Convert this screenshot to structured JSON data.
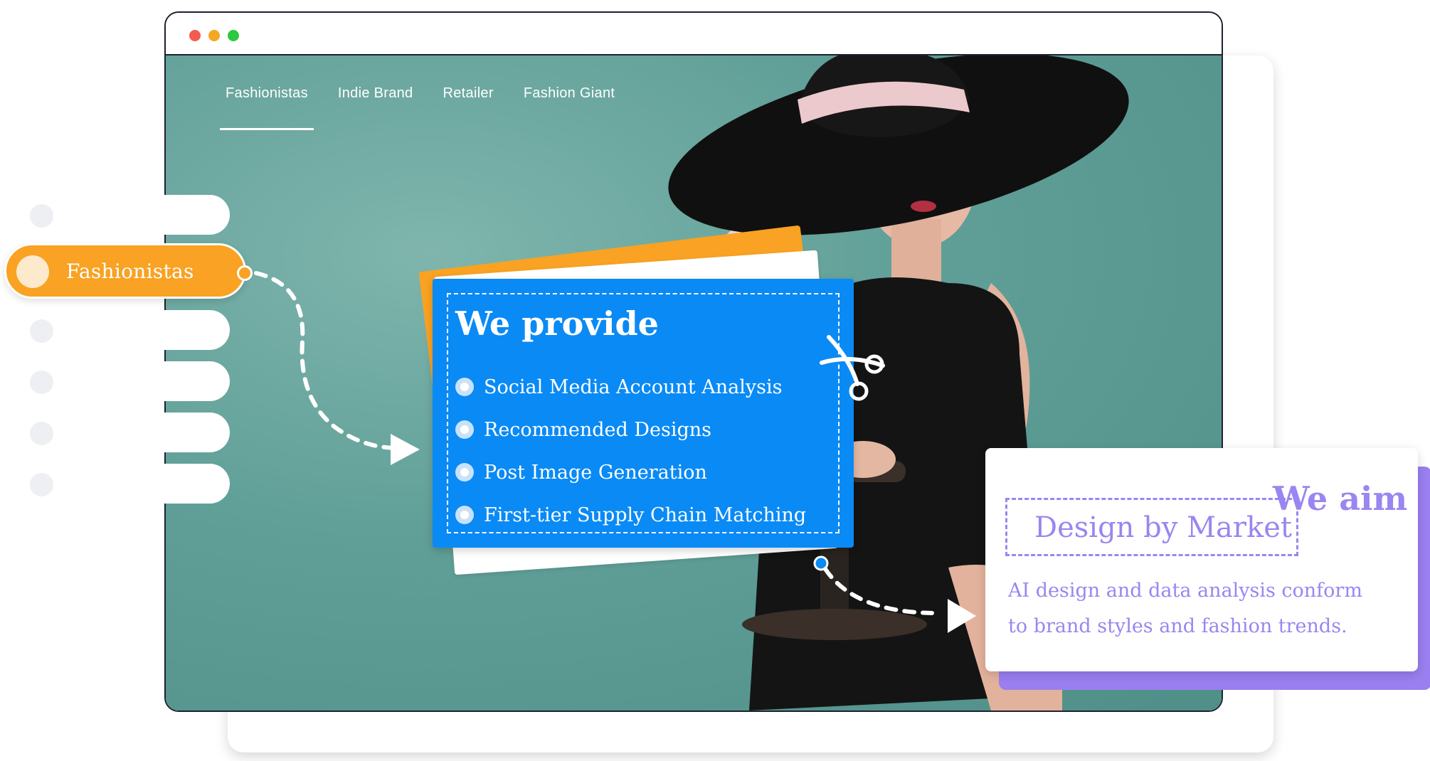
{
  "window": {
    "controls": [
      "close",
      "minimize",
      "maximize"
    ]
  },
  "nav": {
    "items": [
      "Fashionistas",
      "Indie Brand",
      "Retailer",
      "Fashion Giant"
    ],
    "active": "Fashionistas"
  },
  "sidebar": {
    "active_label": "Fashionistas"
  },
  "provide": {
    "title": "We provide",
    "items": [
      "Social Media Account Analysis",
      "Recommended Designs",
      "Post Image Generation",
      "First-tier Supply Chain Matching"
    ]
  },
  "aim": {
    "title": "We aim",
    "headline": "Design by Market",
    "description_line1": "AI design and data analysis  conform",
    "description_line2": "to brand styles and fashion trends."
  },
  "colors": {
    "accent_orange": "#f9a223",
    "accent_blue": "#0a8af5",
    "accent_purple": "#9b85f0",
    "hero_bg": "#5f9f97"
  },
  "icons": [
    "scissors-icon",
    "arrow-icon"
  ]
}
